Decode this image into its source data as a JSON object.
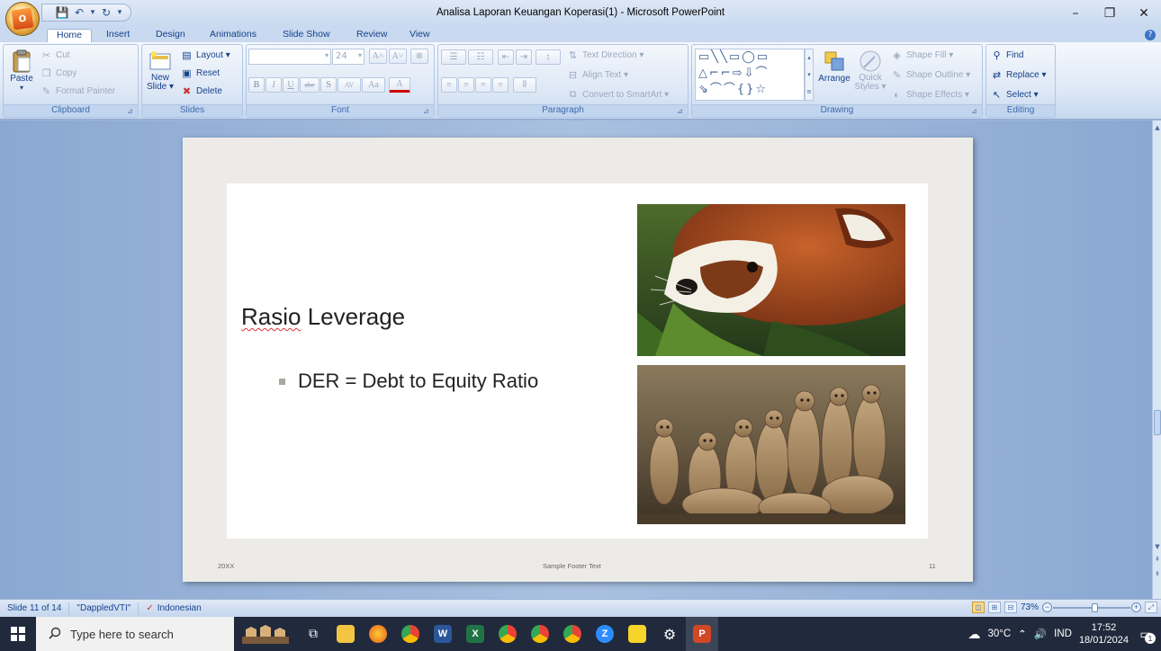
{
  "window": {
    "title": "Analisa Laporan Keuangan Koperasi(1) - Microsoft PowerPoint",
    "minimize": "–",
    "maximize": "❐",
    "close": "✕"
  },
  "office_button": {
    "glyph": "O"
  },
  "quick_access": {
    "save_icon": "💾",
    "undo_icon": "↶",
    "undo_dropdown": "▾",
    "redo_icon": "↻",
    "customize": "▾"
  },
  "tabs": [
    {
      "label": "Home",
      "active": true
    },
    {
      "label": "Insert"
    },
    {
      "label": "Design"
    },
    {
      "label": "Animations"
    },
    {
      "label": "Slide Show"
    },
    {
      "label": "Review"
    },
    {
      "label": "View"
    }
  ],
  "help_icon": "?",
  "ribbon": {
    "clipboard": {
      "label": "Clipboard",
      "paste": "Paste",
      "cut": "Cut",
      "copy": "Copy",
      "format_painter": "Format Painter"
    },
    "slides": {
      "label": "Slides",
      "new_slide": "New Slide ▾",
      "new_slide_line1": "New",
      "new_slide_line2": "Slide ▾",
      "layout": "Layout ▾",
      "reset": "Reset",
      "delete": "Delete"
    },
    "font": {
      "label": "Font",
      "font_name": "",
      "font_size": "24",
      "bold": "B",
      "italic": "I",
      "underline": "U",
      "strike": "abc",
      "shadow": "S",
      "spacing": "AV",
      "case": "Aa",
      "color": "A",
      "grow": "A˄",
      "shrink": "A˅",
      "clear": "⊗"
    },
    "paragraph": {
      "label": "Paragraph",
      "text_direction": "Text Direction ▾",
      "align_text": "Align Text ▾",
      "convert_smartart": "Convert to SmartArt ▾"
    },
    "drawing": {
      "label": "Drawing",
      "arrange": "Arrange",
      "quick_styles_line1": "Quick",
      "quick_styles_line2": "Styles ▾",
      "shape_fill": "Shape Fill ▾",
      "shape_outline": "Shape Outline ▾",
      "shape_effects": "Shape Effects ▾"
    },
    "editing": {
      "label": "Editing",
      "find": "Find",
      "replace": "Replace ▾",
      "select": "Select ▾"
    }
  },
  "slide": {
    "title_part1": "Rasio",
    "title_part2": " Leverage",
    "bullet": "DER = Debt to Equity Ratio",
    "footer_date": "20XX",
    "footer_text": "Sample Footer Text",
    "footer_num": "11"
  },
  "statusbar": {
    "slide_info": "Slide 11 of 14",
    "theme": "\"DappledVTI\"",
    "language": "Indonesian",
    "zoom": "73%",
    "zoom_fraction": 0.55
  },
  "taskbar": {
    "search_placeholder": "Type here to search",
    "temperature": "30°C",
    "lang": "IND",
    "time": "17:52",
    "date": "18/01/2024",
    "notifications": "1"
  }
}
